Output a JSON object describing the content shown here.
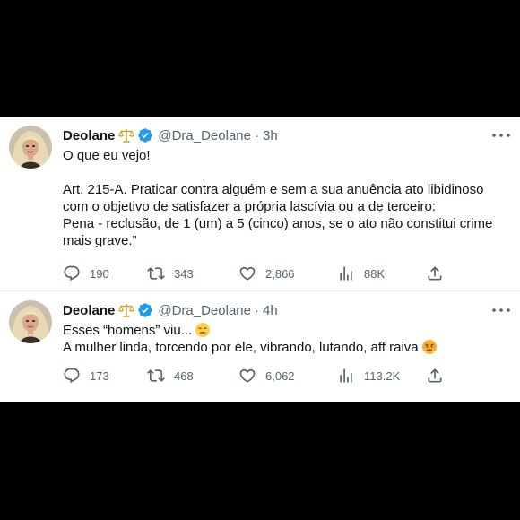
{
  "tweets": [
    {
      "author": {
        "name": "Deolane",
        "handle": "@Dra_Deolane",
        "separator": "·",
        "time": "3h",
        "badge_icon": "scale-icon",
        "verified_icon": "verified-badge-icon"
      },
      "lines": [
        "O que eu vejo!",
        "",
        "Art. 215-A. Praticar contra alguém e sem a sua anuência ato libidinoso",
        "com o objetivo de satisfazer a própria lascívia ou a de terceiro:",
        "Pena - reclusão, de 1 (um) a 5 (cinco) anos, se o ato não constitui crime",
        "mais grave.”"
      ],
      "stats": {
        "replies": "190",
        "retweets": "343",
        "likes": "2,866",
        "views": "88K"
      }
    },
    {
      "author": {
        "name": "Deolane",
        "handle": "@Dra_Deolane",
        "separator": "·",
        "time": "4h",
        "badge_icon": "scale-icon",
        "verified_icon": "verified-badge-icon"
      },
      "lines": [
        "Esses “homens” viu...",
        "A mulher linda, torcendo por ele, vibrando, lutando, aff raiva"
      ],
      "line_emojis": [
        "unamused-face-emoji",
        "angry-face-emoji"
      ],
      "stats": {
        "replies": "173",
        "retweets": "468",
        "likes": "6,062",
        "views": "113.2K"
      }
    }
  ],
  "colors": {
    "text": "#0f1419",
    "muted": "#536471",
    "verified": "#1d9bf0",
    "background": "#000000",
    "card": "#ffffff"
  }
}
